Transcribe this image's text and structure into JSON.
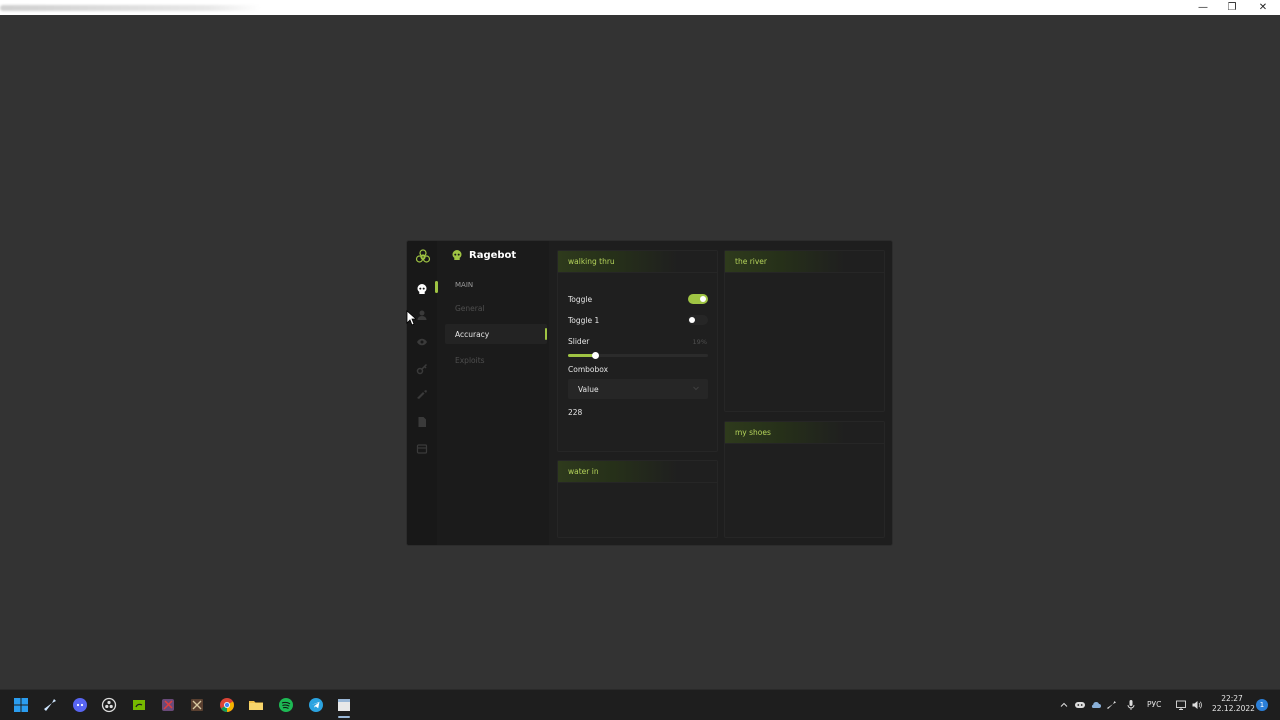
{
  "window": {
    "minimize_glyph": "—",
    "maximize_glyph": "❐",
    "close_glyph": "✕"
  },
  "menu": {
    "brand": {
      "title": "Ragebot",
      "icon": "skull-icon"
    },
    "iconbar": [
      "biohazard-logo-icon",
      "skull-icon",
      "user-icon",
      "eye-icon",
      "key-icon",
      "rifle-icon",
      "file-icon",
      "archive-icon"
    ],
    "section_label": "MAIN",
    "tabs": [
      {
        "label": "General",
        "active": false
      },
      {
        "label": "Accuracy",
        "active": true
      },
      {
        "label": "Exploits",
        "active": false
      }
    ],
    "groups": {
      "walking_thru": {
        "title": "walking thru",
        "toggle": {
          "label": "Toggle",
          "on": true
        },
        "toggle1": {
          "label": "Toggle 1",
          "on": false
        },
        "slider": {
          "label": "Slider",
          "value_text": "19%",
          "value": 19
        },
        "combobox": {
          "label": "Combobox",
          "value": "Value"
        },
        "number": "228"
      },
      "the_river": {
        "title": "the river"
      },
      "my_shoes": {
        "title": "my shoes"
      },
      "water_in": {
        "title": "water in"
      }
    },
    "accent_color": "#9fc443"
  },
  "taskbar": {
    "apps": [
      "windows-start-icon",
      "steam-icon",
      "discord-icon",
      "obs-icon",
      "nvidia-icon",
      "game-icon",
      "app-icon",
      "chrome-icon",
      "file-explorer-icon",
      "spotify-icon",
      "telegram-icon",
      "active-window-icon"
    ],
    "tray": [
      "chevron-up-icon",
      "discord-tray-icon",
      "cloud-icon",
      "steam-tray-icon",
      "mic-icon"
    ],
    "language": "РУС",
    "time": "22:27",
    "date": "22.12.2022",
    "notifications": "1"
  }
}
